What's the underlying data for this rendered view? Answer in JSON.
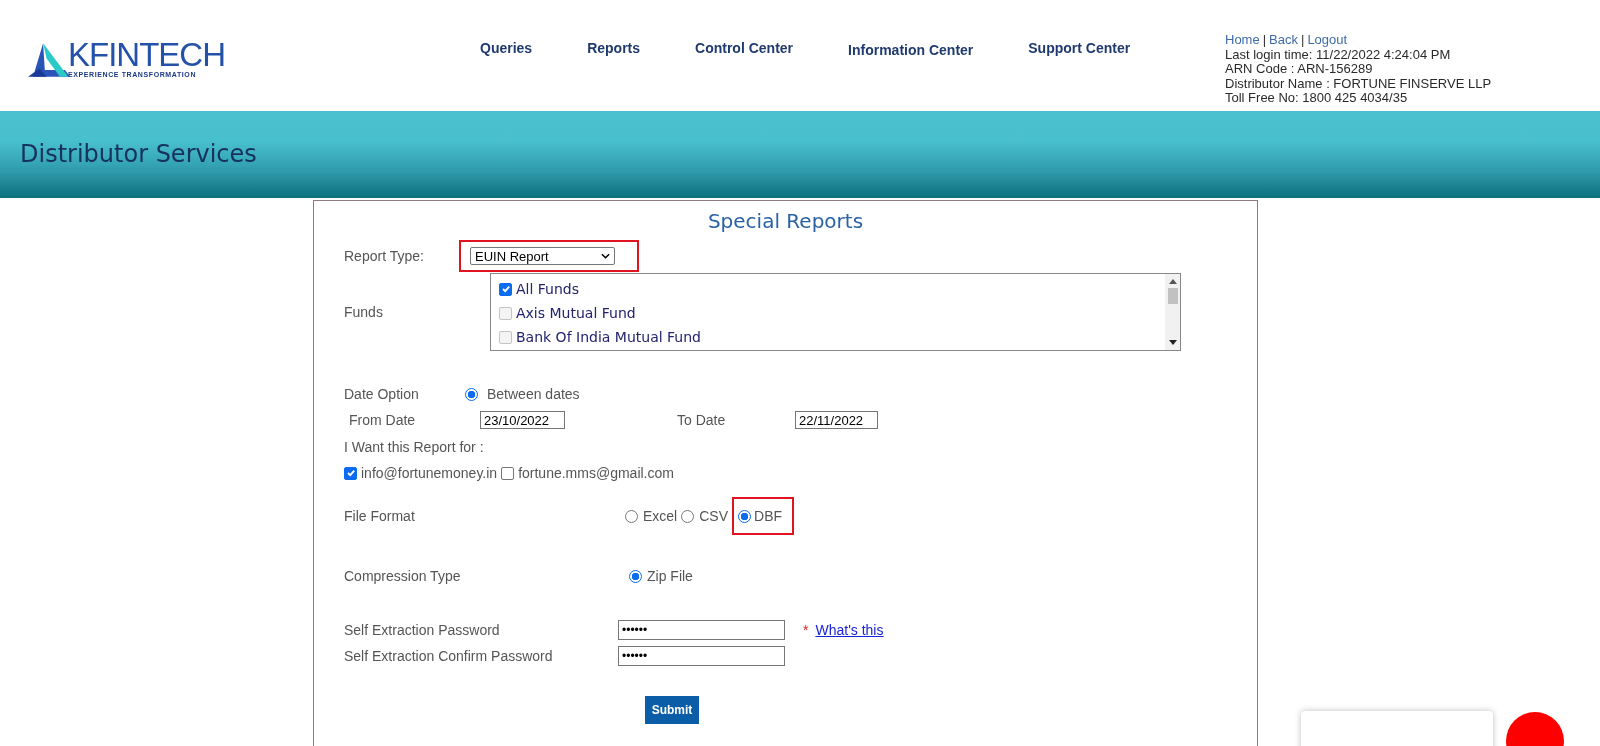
{
  "logo": {
    "name": "KFINTECH",
    "tagline": "EXPERIENCE TRANSFORMATION"
  },
  "nav": [
    "Queries",
    "Reports",
    "Control Center",
    "Information Center",
    "Support Center"
  ],
  "user_links": [
    "Home",
    "Back",
    "Logout"
  ],
  "link_separator": "|",
  "user_info": [
    "Last login time: 11/22/2022 4:24:04 PM",
    "ARN Code : ARN-156289",
    "Distributor Name : FORTUNE FINSERVE LLP",
    "Toll Free No: 1800 425 4034/35"
  ],
  "banner": {
    "title": "Distributor Services"
  },
  "form": {
    "title": "Special Reports",
    "report_type": {
      "label": "Report Type:",
      "value": "EUIN Report",
      "highlighted": true
    },
    "funds": {
      "label": "Funds",
      "items": [
        {
          "name": "All Funds",
          "checked": true,
          "disabled": false
        },
        {
          "name": "Axis Mutual Fund",
          "checked": false,
          "disabled": true
        },
        {
          "name": "Bank Of India Mutual Fund",
          "checked": false,
          "disabled": true
        }
      ]
    },
    "date_option": {
      "label": "Date Option",
      "options": [
        {
          "label": "Between dates",
          "selected": true
        }
      ]
    },
    "from_date": {
      "label": "From Date",
      "value": "23/10/2022"
    },
    "to_date": {
      "label": "To Date",
      "value": "22/11/2022"
    },
    "report_for": {
      "label": "I Want this Report for :",
      "emails": [
        {
          "address": "info@fortunemoney.in",
          "checked": true
        },
        {
          "address": "fortune.mms@gmail.com",
          "checked": false
        }
      ]
    },
    "file_format": {
      "label": "File Format",
      "options": [
        {
          "label": "Excel",
          "selected": false,
          "highlighted": false
        },
        {
          "label": "CSV",
          "selected": false,
          "highlighted": false
        },
        {
          "label": "DBF",
          "selected": true,
          "highlighted": true
        }
      ]
    },
    "compression": {
      "label": "Compression Type",
      "options": [
        {
          "label": "Zip File",
          "selected": true
        }
      ]
    },
    "password": {
      "label": "Self Extraction Password",
      "value": "••••••",
      "required_mark": "*",
      "help_link": "What's this"
    },
    "confirm_password": {
      "label": "Self Extraction Confirm Password",
      "value": "••••••"
    },
    "submit": "Submit"
  }
}
